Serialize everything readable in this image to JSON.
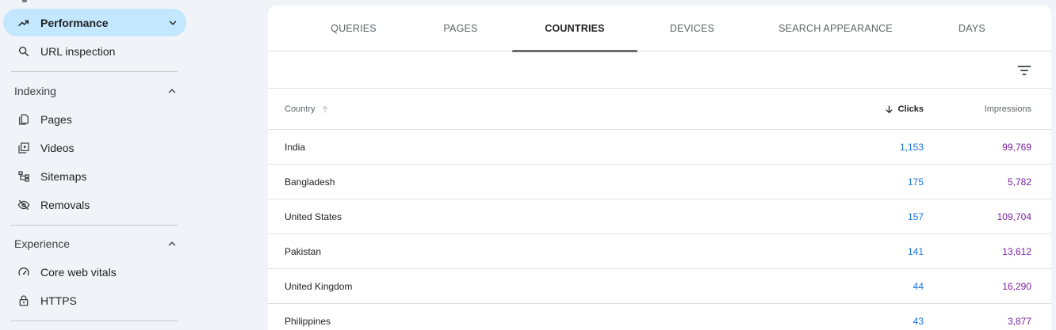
{
  "sidebar": {
    "performance": {
      "label": "Performance",
      "icon": "trending-up-icon"
    },
    "url_inspection": {
      "label": "URL inspection",
      "icon": "search-icon"
    },
    "indexing": {
      "title": "Indexing",
      "items": [
        {
          "label": "Pages",
          "icon": "pages-icon"
        },
        {
          "label": "Videos",
          "icon": "video-icon"
        },
        {
          "label": "Sitemaps",
          "icon": "sitemap-icon"
        },
        {
          "label": "Removals",
          "icon": "eye-off-icon"
        }
      ]
    },
    "experience": {
      "title": "Experience",
      "items": [
        {
          "label": "Core web vitals",
          "icon": "speed-gauge-icon"
        },
        {
          "label": "HTTPS",
          "icon": "lock-icon"
        }
      ]
    }
  },
  "tabs": [
    {
      "label": "QUERIES",
      "active": false
    },
    {
      "label": "PAGES",
      "active": false
    },
    {
      "label": "COUNTRIES",
      "active": true
    },
    {
      "label": "DEVICES",
      "active": false
    },
    {
      "label": "SEARCH APPEARANCE",
      "active": false
    },
    {
      "label": "DAYS",
      "active": false
    }
  ],
  "table": {
    "columns": {
      "country": "Country",
      "clicks": "Clicks",
      "impressions": "Impressions"
    },
    "rows": [
      {
        "country": "India",
        "clicks": "1,153",
        "impressions": "99,769"
      },
      {
        "country": "Bangladesh",
        "clicks": "175",
        "impressions": "5,782"
      },
      {
        "country": "United States",
        "clicks": "157",
        "impressions": "109,704"
      },
      {
        "country": "Pakistan",
        "clicks": "141",
        "impressions": "13,612"
      },
      {
        "country": "United Kingdom",
        "clicks": "44",
        "impressions": "16,290"
      },
      {
        "country": "Philippines",
        "clicks": "43",
        "impressions": "3,877"
      }
    ]
  },
  "colors": {
    "active_nav_bg": "#c2e7ff",
    "clicks": "#1a73e8",
    "impressions": "#7b1fa2",
    "page_bg": "#f0f4f9"
  }
}
